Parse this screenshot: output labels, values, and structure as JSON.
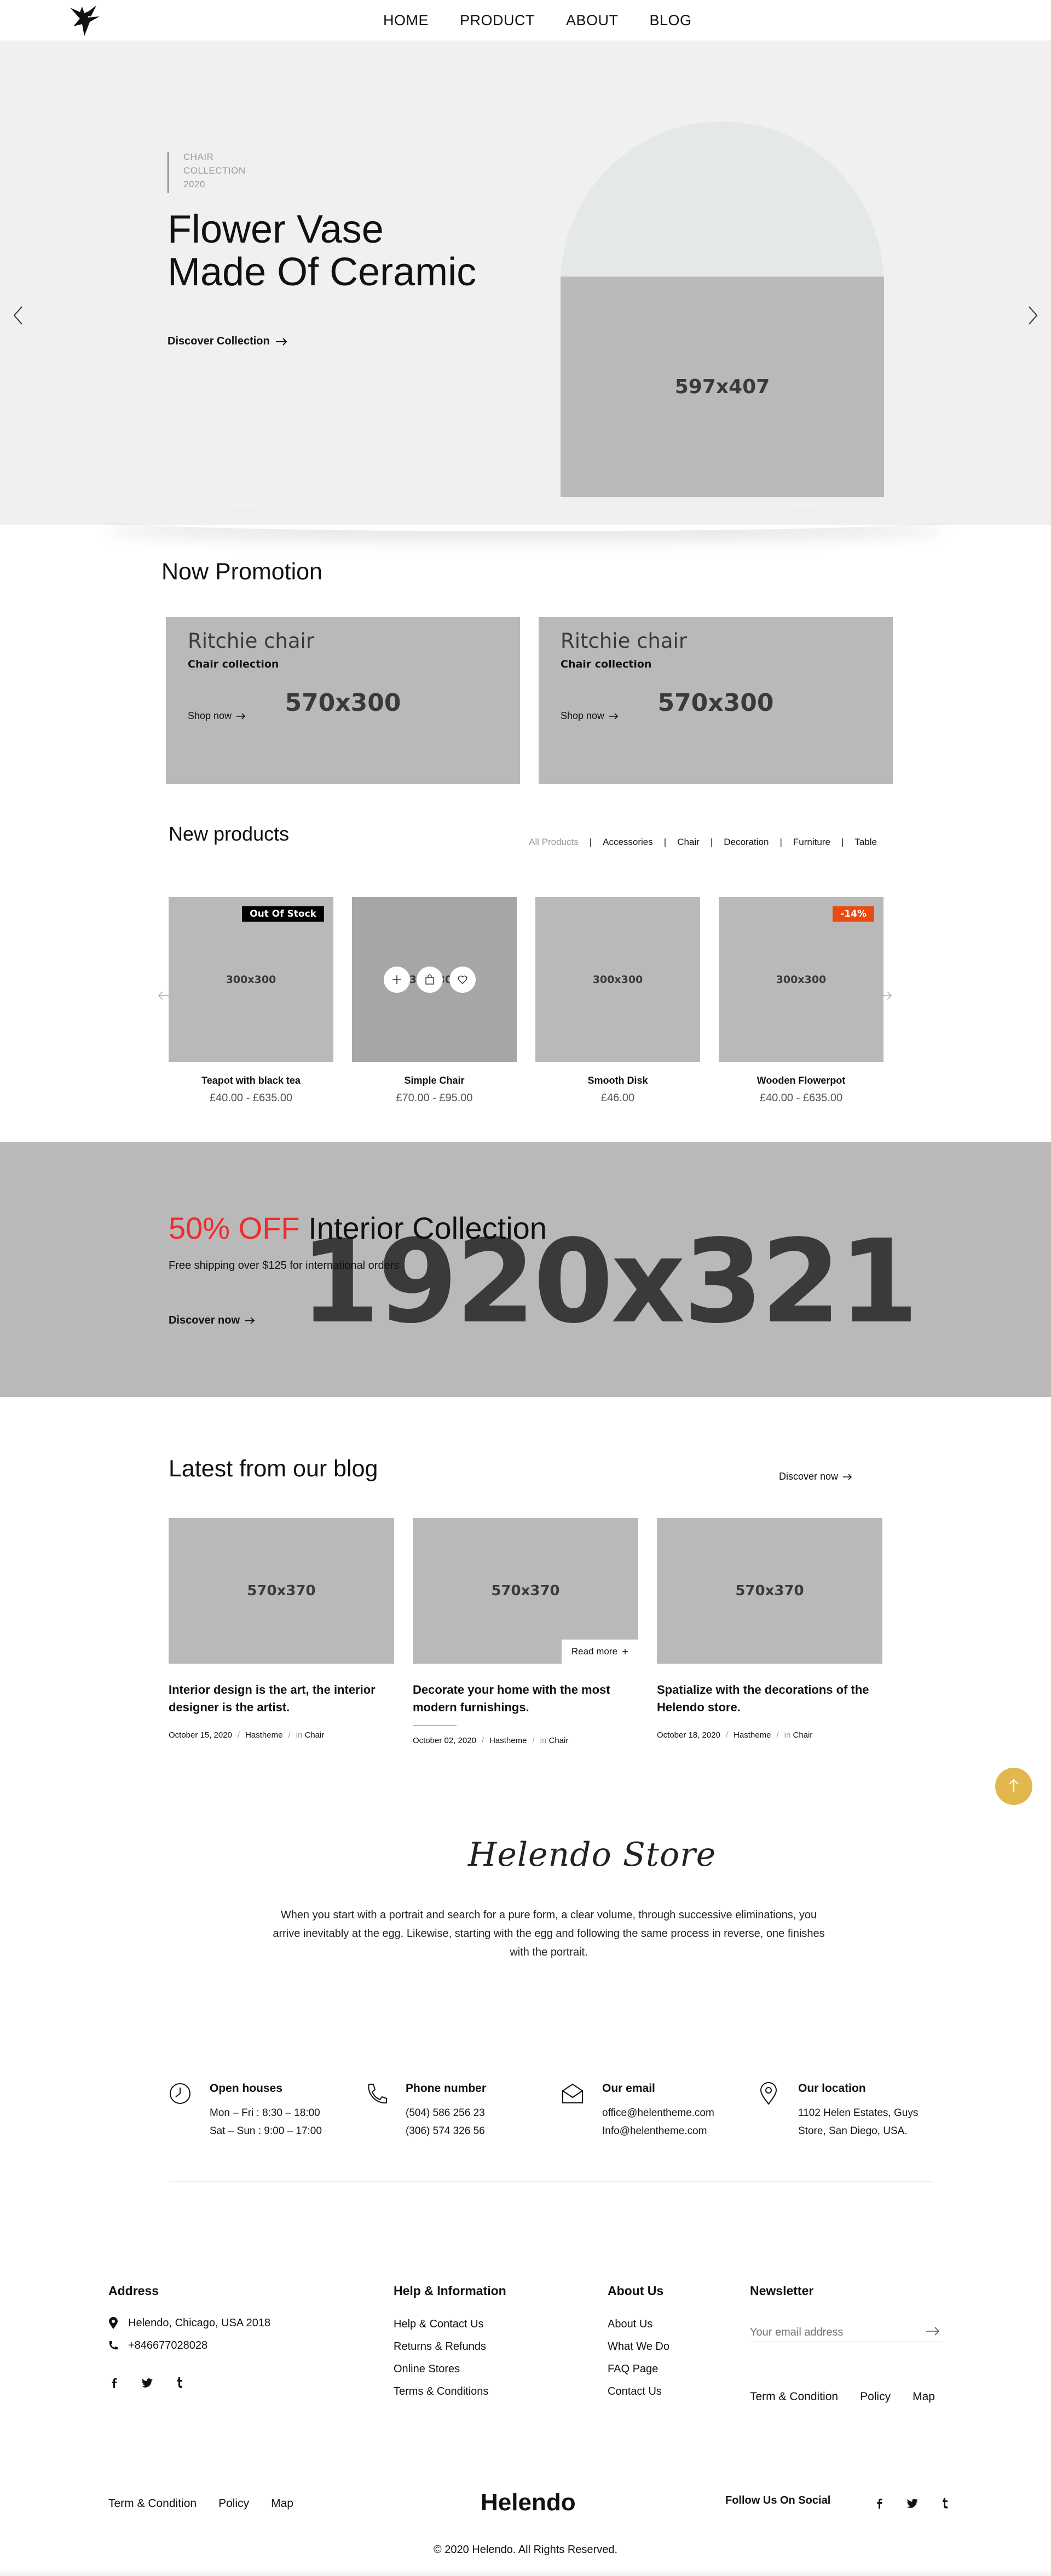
{
  "header": {
    "nav": [
      "HOME",
      "PRODUCT",
      "ABOUT",
      "BLOG"
    ]
  },
  "hero": {
    "tag_lines": [
      "CHAIR",
      "COLLECTION",
      "2020"
    ],
    "title_line1": "Flower Vase",
    "title_line2": "Made Of Ceramic",
    "cta": "Discover Collection",
    "image_label": "597x407"
  },
  "promotion": {
    "title": "Now Promotion",
    "cards": [
      {
        "name": "Ritchie chair",
        "sub": "Chair collection",
        "shop": "Shop now",
        "image_label": "570x300"
      },
      {
        "name": "Ritchie chair",
        "sub": "Chair collection",
        "shop": "Shop now",
        "image_label": "570x300"
      }
    ]
  },
  "new_products": {
    "title": "New products",
    "filters": [
      "All Products",
      "Accessories",
      "Chair",
      "Decoration",
      "Furniture",
      "Table"
    ],
    "active_filter": "All Products",
    "products": [
      {
        "name": "Teapot with black tea",
        "price": "£40.00 - £635.00",
        "image_label": "300x300",
        "badge": "Out Of Stock"
      },
      {
        "name": "Simple Chair",
        "price": "£70.00 - £95.00",
        "image_label": "300x300",
        "badge": ""
      },
      {
        "name": "Smooth Disk",
        "price": "£46.00",
        "image_label": "300x300",
        "badge": ""
      },
      {
        "name": "Wooden Flowerpot",
        "price": "£40.00 - £635.00",
        "image_label": "300x300",
        "badge": "-14%"
      }
    ],
    "colors": {
      "out_of_stock": "#000000",
      "sale": "#ea4b12"
    }
  },
  "offer": {
    "percent": "50% OFF",
    "title": "Interior Collection",
    "shipping": "Free shipping over $125 for international orders",
    "cta": "Discover now",
    "image_label": "1920x321",
    "accent": "#ef2b2b"
  },
  "blog": {
    "title": "Latest from our blog",
    "cta": "Discover now",
    "read_more": "Read more",
    "posts": [
      {
        "title": "Interior design is the art, the interior designer is the artist.",
        "date": "October 15, 2020",
        "author": "Hastheme",
        "in": "in",
        "category": "Chair",
        "image_label": "570x370"
      },
      {
        "title": "Decorate your home with the most modern furnishings.",
        "date": "October 02, 2020",
        "author": "Hastheme",
        "in": "in",
        "category": "Chair",
        "image_label": "570x370"
      },
      {
        "title": "Spatialize with the decorations of the Helendo store.",
        "date": "October 18, 2020",
        "author": "Hastheme",
        "in": "in",
        "category": "Chair",
        "image_label": "570x370"
      }
    ]
  },
  "store": {
    "signature": "Helendo Store",
    "text": "When you start with a portrait and search for a pure form, a clear volume, through successive eliminations, you arrive inevitably at the egg. Likewise, starting with the egg and following the same process in reverse, one finishes with the portrait."
  },
  "contact": {
    "open": {
      "title": "Open houses",
      "lines": [
        "Mon – Fri : 8:30 – 18:00",
        "Sat – Sun : 9:00 – 17:00"
      ]
    },
    "phone": {
      "title": "Phone number",
      "lines": [
        "(504) 586 256 23",
        "(306) 574 326 56"
      ]
    },
    "email": {
      "title": "Our email",
      "lines": [
        "office@helentheme.com",
        "Info@helentheme.com"
      ]
    },
    "location": {
      "title": "Our location",
      "lines": [
        "1102 Helen Estates, Guys",
        "Store, San Diego, USA."
      ]
    }
  },
  "footer": {
    "address_title": "Address",
    "address": "Helendo, Chicago, USA 2018",
    "phone": "+846677028028",
    "help_title": "Help & Information",
    "help_items": [
      "Help & Contact Us",
      "Returns & Refunds",
      "Online Stores",
      "Terms & Conditions"
    ],
    "about_title": "About Us",
    "about_items": [
      "About Us",
      "What We Do",
      "FAQ Page",
      "Contact Us"
    ],
    "newsletter_title": "Newsletter",
    "newsletter_placeholder": "Your email address",
    "links": [
      "Term & Condition",
      "Policy",
      "Map"
    ],
    "brand": "Helendo",
    "follow": "Follow Us On Social",
    "copyright": "© 2020 Helendo. All Rights Reserved."
  }
}
